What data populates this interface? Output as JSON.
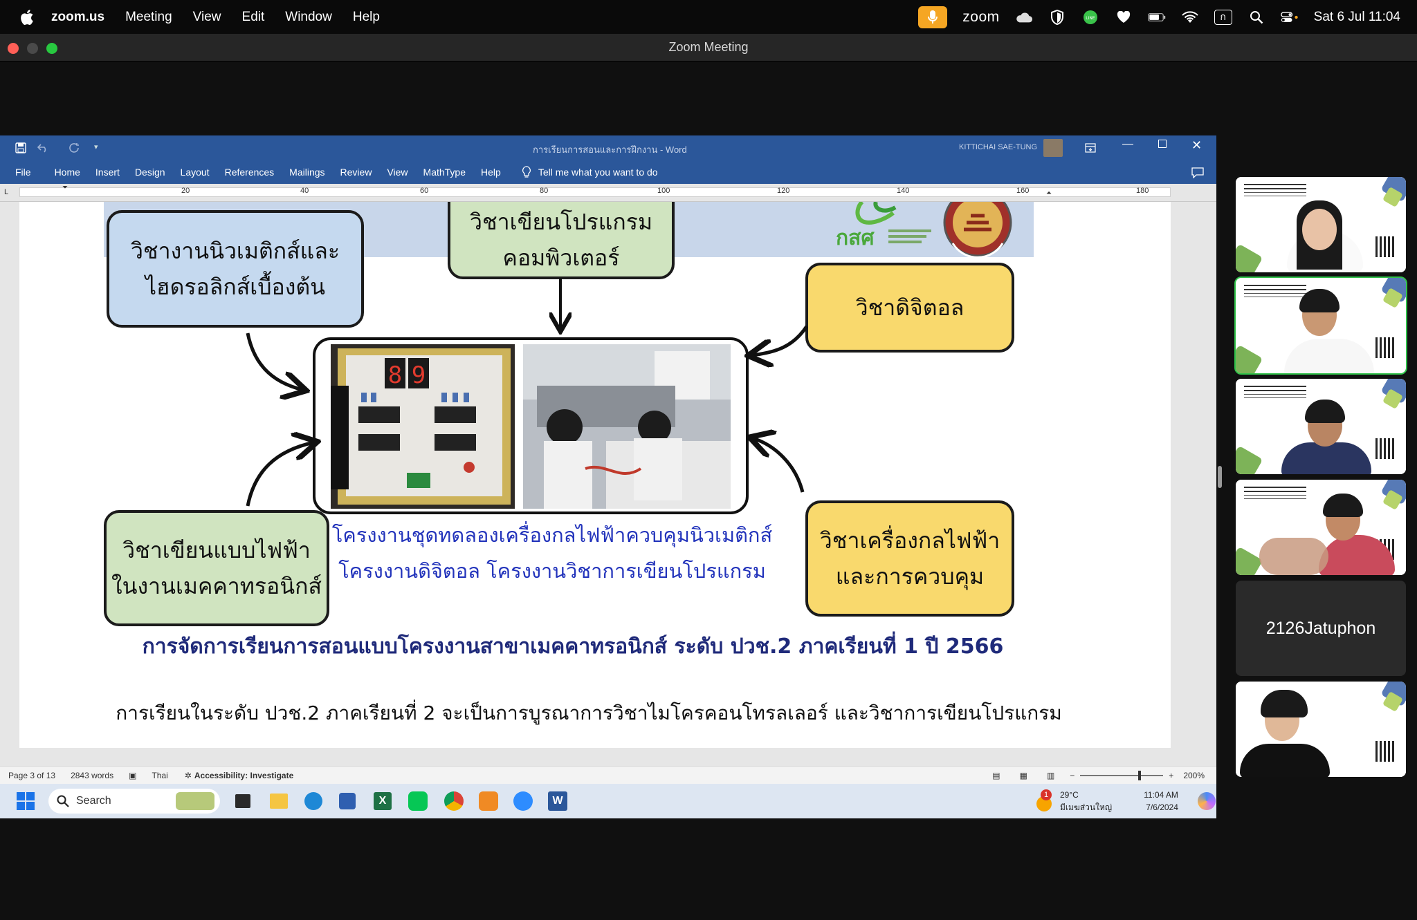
{
  "menubar": {
    "app": "zoom.us",
    "items": [
      "Meeting",
      "View",
      "Edit",
      "Window",
      "Help"
    ],
    "zoom_label": "zoom",
    "clock": "Sat 6 Jul  11:04",
    "input_source": "ก"
  },
  "zoom_window": {
    "title": "Zoom Meeting"
  },
  "word": {
    "doc_title": "การเรียนการสอนและการฝึกงาน - Word",
    "user": "KITTICHAI SAE-TUNG",
    "tabs": [
      "File",
      "Home",
      "Insert",
      "Design",
      "Layout",
      "References",
      "Mailings",
      "Review",
      "View",
      "MathType",
      "Help"
    ],
    "tell_me": "Tell me what you want to do",
    "ruler_marks": [
      "20",
      "40",
      "60",
      "80",
      "100",
      "120",
      "140",
      "160",
      "180"
    ]
  },
  "document": {
    "box_pneumatic": [
      "วิชางานนิวเมติกส์และ",
      "ไฮดรอลิกส์เบื้องต้น"
    ],
    "box_programming": [
      "วิชาเขียนโปรแกรม",
      "คอมพิวเตอร์"
    ],
    "box_digital": "วิชาดิจิตอล",
    "box_electrical_drawing": [
      "วิชาเขียนแบบไฟฟ้า",
      "ในงานเมคคาทรอนิกส์"
    ],
    "box_machines": [
      "วิชาเครื่องกลไฟฟ้า",
      "และการควบคุม"
    ],
    "project_caption": [
      "โครงงานชุดทดลองเครื่องกลไฟฟ้าควบคุมนิวเมติกส์",
      "โครงงานดิจิตอล โครงงานวิชาการเขียนโปรแกรม"
    ],
    "figure_title": "การจัดการเรียนการสอนแบบโครงงานสาขาเมคคาทรอนิกส์ ระดับ ปวช.2 ภาคเรียนที่ 1 ปี 2566",
    "body_text": "การเรียนในระดับ ปวช.2 ภาคเรียนที่ 2 จะเป็นการบูรณาการวิชาไมโครคอนโทรลเลอร์ และวิชาการเขียนโปรแกรม",
    "logo_text": "กสศ",
    "seven_segment": [
      "8",
      "9"
    ]
  },
  "statusbar": {
    "page": "Page 3 of 13",
    "words": "2843 words",
    "language": "Thai",
    "accessibility": "Accessibility: Investigate",
    "zoom": "200%"
  },
  "taskbar": {
    "search": "Search",
    "weather_temp": "29°C",
    "weather_place": "มีเมฆส่วนใหญ่",
    "weather_badge": "1",
    "time": "11:04 AM",
    "date": "7/6/2024"
  },
  "participants": {
    "name_only": "2126Jatuphon"
  },
  "colors": {
    "word_blue": "#2b579a",
    "box_blue": "#c5d9ef",
    "box_green": "#d0e4c0",
    "box_yellow": "#f9d96d",
    "caption_blue": "#2233bb",
    "title_navy": "#1f2a7a",
    "active_speaker": "#30c24a"
  }
}
